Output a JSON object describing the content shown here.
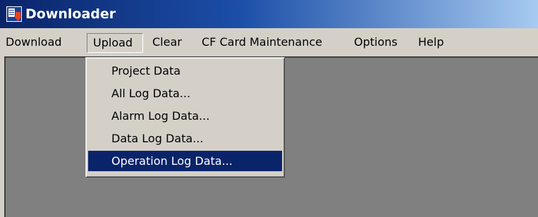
{
  "window": {
    "title": "Downloader",
    "icon": "downloader-app-icon"
  },
  "menubar": {
    "items": [
      "Download",
      "Upload",
      "Clear",
      "CF Card Maintenance",
      "Options",
      "Help"
    ],
    "open_menu": "Upload"
  },
  "upload_menu": {
    "items": [
      "Project Data",
      "All Log Data...",
      "Alarm Log Data...",
      "Data Log Data...",
      "Operation Log Data..."
    ],
    "selected": "Operation Log Data..."
  },
  "colors": {
    "titlebar_start": "#0a246a",
    "titlebar_end": "#a6caf0",
    "menu_face": "#d4d0c8",
    "client_area": "#808080",
    "highlight": "#0a246a"
  }
}
